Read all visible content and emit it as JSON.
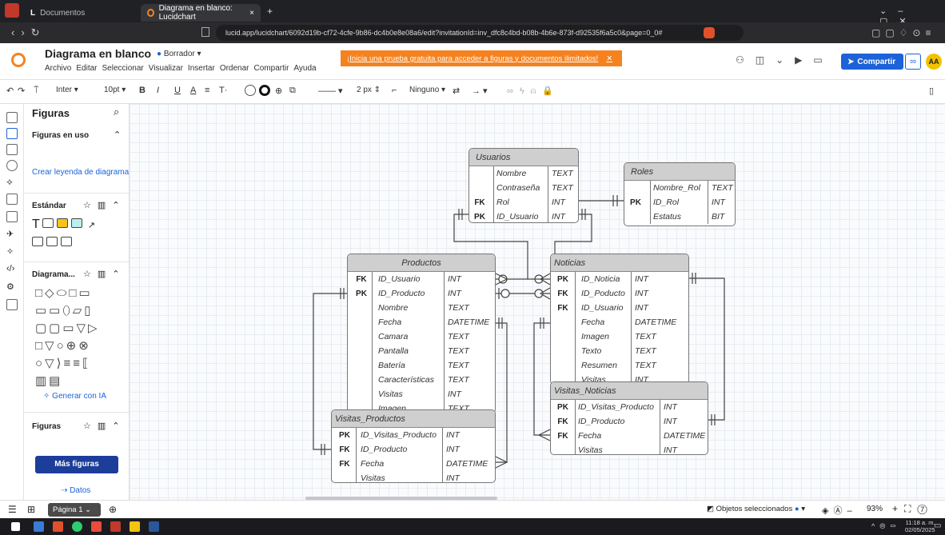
{
  "browser": {
    "tabs": [
      {
        "label": "Documentos"
      },
      {
        "label": "Diagrama en blanco: Lucidchart"
      }
    ],
    "tab_close": "×",
    "new_tab": "+",
    "url": "lucid.app/lucidchart/6092d19b-cf72-4cfe-9b86-dc4b0e8e08a6/edit?invitationId=inv_dfc8c4bd-b08b-4b6e-873f-d92535f6a5c0&page=0_0#"
  },
  "app": {
    "doc_title": "Diagrama en blanco",
    "status": "Borrador",
    "menus": [
      "Archivo",
      "Editar",
      "Seleccionar",
      "Visualizar",
      "Insertar",
      "Ordenar",
      "Compartir",
      "Ayuda"
    ],
    "promo": "¡Inicia una prueba gratuita para acceder a figuras y documentos ilimitados!",
    "share_label": "Compartir",
    "avatar": "AA"
  },
  "toolbar": {
    "font": "Inter",
    "size": "10pt",
    "bold": "B",
    "italic": "I",
    "underline": "U",
    "color": "A",
    "stroke_width": "2 px",
    "line_end": "Ninguno"
  },
  "side": {
    "title": "Figuras",
    "in_use": "Figuras en uso",
    "legend_link": "Crear leyenda de diagrama",
    "standard": "Estándar",
    "diagrama": "Diagrama...",
    "generate": "Generar con IA",
    "figuras": "Figuras",
    "more": "Más figuras",
    "datos": "Datos"
  },
  "entities": {
    "usuarios": {
      "title": "Usuarios",
      "rows": [
        {
          "k": "",
          "f": "Nombre",
          "t": "TEXT"
        },
        {
          "k": "",
          "f": "Contraseña",
          "t": "TEXT"
        },
        {
          "k": "FK",
          "f": "Rol",
          "t": "INT"
        },
        {
          "k": "PK",
          "f": "ID_Usuario",
          "t": "INT"
        }
      ]
    },
    "roles": {
      "title": "Roles",
      "rows": [
        {
          "k": "",
          "f": "Nombre_Rol",
          "t": "TEXT"
        },
        {
          "k": "PK",
          "f": "ID_Rol",
          "t": "INT"
        },
        {
          "k": "",
          "f": "Estatus",
          "t": "BIT"
        }
      ]
    },
    "productos": {
      "title": "Productos",
      "rows": [
        {
          "k": "FK",
          "f": "ID_Usuario",
          "t": "INT"
        },
        {
          "k": "PK",
          "f": "ID_Producto",
          "t": "INT"
        },
        {
          "k": "",
          "f": "Nombre",
          "t": "TEXT"
        },
        {
          "k": "",
          "f": "Fecha",
          "t": "DATETIME"
        },
        {
          "k": "",
          "f": "Camara",
          "t": "TEXT"
        },
        {
          "k": "",
          "f": "Pantalla",
          "t": "TEXT"
        },
        {
          "k": "",
          "f": "Batería",
          "t": "TEXT"
        },
        {
          "k": "",
          "f": "Características",
          "t": "TEXT"
        },
        {
          "k": "",
          "f": "Visitas",
          "t": "INT"
        },
        {
          "k": "",
          "f": "Imagen",
          "t": "TEXT"
        }
      ]
    },
    "noticias": {
      "title": "Noticias",
      "rows": [
        {
          "k": "PK",
          "f": "ID_Noticia",
          "t": "INT"
        },
        {
          "k": "FK",
          "f": "ID_Poducto",
          "t": "INT"
        },
        {
          "k": "FK",
          "f": "ID_Usuario",
          "t": "INT"
        },
        {
          "k": "",
          "f": "Fecha",
          "t": "DATETIME"
        },
        {
          "k": "",
          "f": "Imagen",
          "t": "TEXT"
        },
        {
          "k": "",
          "f": "Texto",
          "t": "TEXT"
        },
        {
          "k": "",
          "f": "Resumen",
          "t": "TEXT"
        },
        {
          "k": "",
          "f": "Visitas",
          "t": "INT"
        }
      ]
    },
    "visitas_productos": {
      "title": "Visitas_Productos",
      "rows": [
        {
          "k": "PK",
          "f": "ID_Visitas_Producto",
          "t": "INT"
        },
        {
          "k": "FK",
          "f": "ID_Producto",
          "t": "INT"
        },
        {
          "k": "FK",
          "f": "Fecha",
          "t": "DATETIME"
        },
        {
          "k": "",
          "f": "Visitas",
          "t": "INT"
        }
      ]
    },
    "visitas_noticias": {
      "title": "Visitas_Noticias",
      "rows": [
        {
          "k": "PK",
          "f": "ID_Visitas_Producto",
          "t": "INT"
        },
        {
          "k": "FK",
          "f": "ID_Producto",
          "t": "INT"
        },
        {
          "k": "FK",
          "f": "Fecha",
          "t": "DATETIME"
        },
        {
          "k": "",
          "f": "Visitas",
          "t": "INT"
        }
      ]
    }
  },
  "bottom": {
    "page": "Página 1",
    "selected": "Objetos seleccionados",
    "zoom": "93%"
  },
  "taskbar": {
    "time": "11:18 a. m.",
    "date": "02/05/2025"
  }
}
